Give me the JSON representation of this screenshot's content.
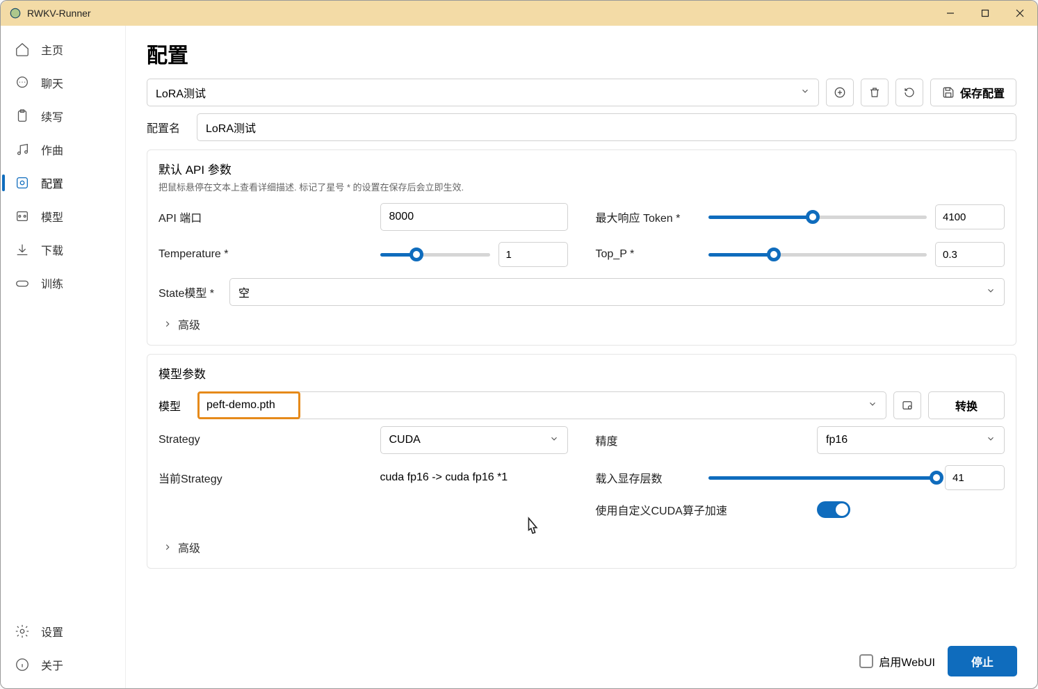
{
  "window": {
    "title": "RWKV-Runner"
  },
  "sidebar": {
    "items": [
      {
        "label": "主页"
      },
      {
        "label": "聊天"
      },
      {
        "label": "续写"
      },
      {
        "label": "作曲"
      },
      {
        "label": "配置"
      },
      {
        "label": "模型"
      },
      {
        "label": "下载"
      },
      {
        "label": "训练"
      }
    ],
    "bottom": [
      {
        "label": "设置"
      },
      {
        "label": "关于"
      }
    ]
  },
  "page": {
    "title": "配置",
    "config_selected": "LoRA测试",
    "save_btn": "保存配置",
    "config_name_label": "配置名",
    "config_name_value": "LoRA测试"
  },
  "api_card": {
    "title": "默认 API 参数",
    "desc": "把鼠标悬停在文本上查看详细描述. 标记了星号 * 的设置在保存后会立即生效.",
    "port_label": "API 端口",
    "port_value": "8000",
    "max_tokens_label": "最大响应 Token *",
    "max_tokens_value": "4100",
    "temp_label": "Temperature *",
    "temp_value": "1",
    "topp_label": "Top_P *",
    "topp_value": "0.3",
    "state_label": "State模型 *",
    "state_value": "空",
    "advanced": "高级"
  },
  "model_card": {
    "title": "模型参数",
    "model_label": "模型",
    "model_value": "peft-demo.pth",
    "convert_btn": "转换",
    "strategy_label": "Strategy",
    "strategy_value": "CUDA",
    "precision_label": "精度",
    "precision_value": "fp16",
    "current_strategy_label": "当前Strategy",
    "current_strategy_value": "cuda fp16 -> cuda fp16 *1",
    "layers_label": "载入显存层数",
    "layers_value": "41",
    "cuda_op_label": "使用自定义CUDA算子加速",
    "advanced": "高级"
  },
  "footer": {
    "webui_label": "启用WebUI",
    "stop_btn": "停止"
  }
}
